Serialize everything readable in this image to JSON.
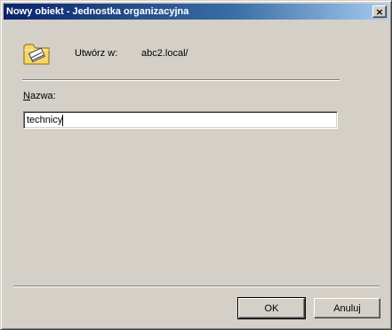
{
  "window": {
    "title": "Nowy obiekt - Jednostka organizacyjna",
    "close_glyph": "×"
  },
  "header": {
    "icon": "folder-icon",
    "create_label": "Utwórz w:",
    "create_path": "abc2.local/"
  },
  "form": {
    "name_label_accel": "N",
    "name_label_rest": "azwa:",
    "name_value": "technicy"
  },
  "buttons": {
    "ok_label": "OK",
    "cancel_label": "Anuluj"
  },
  "colors": {
    "title_start": "#0a246a",
    "title_end": "#a6caf0",
    "face": "#d4d0c8",
    "folder": "#f5d66b"
  }
}
